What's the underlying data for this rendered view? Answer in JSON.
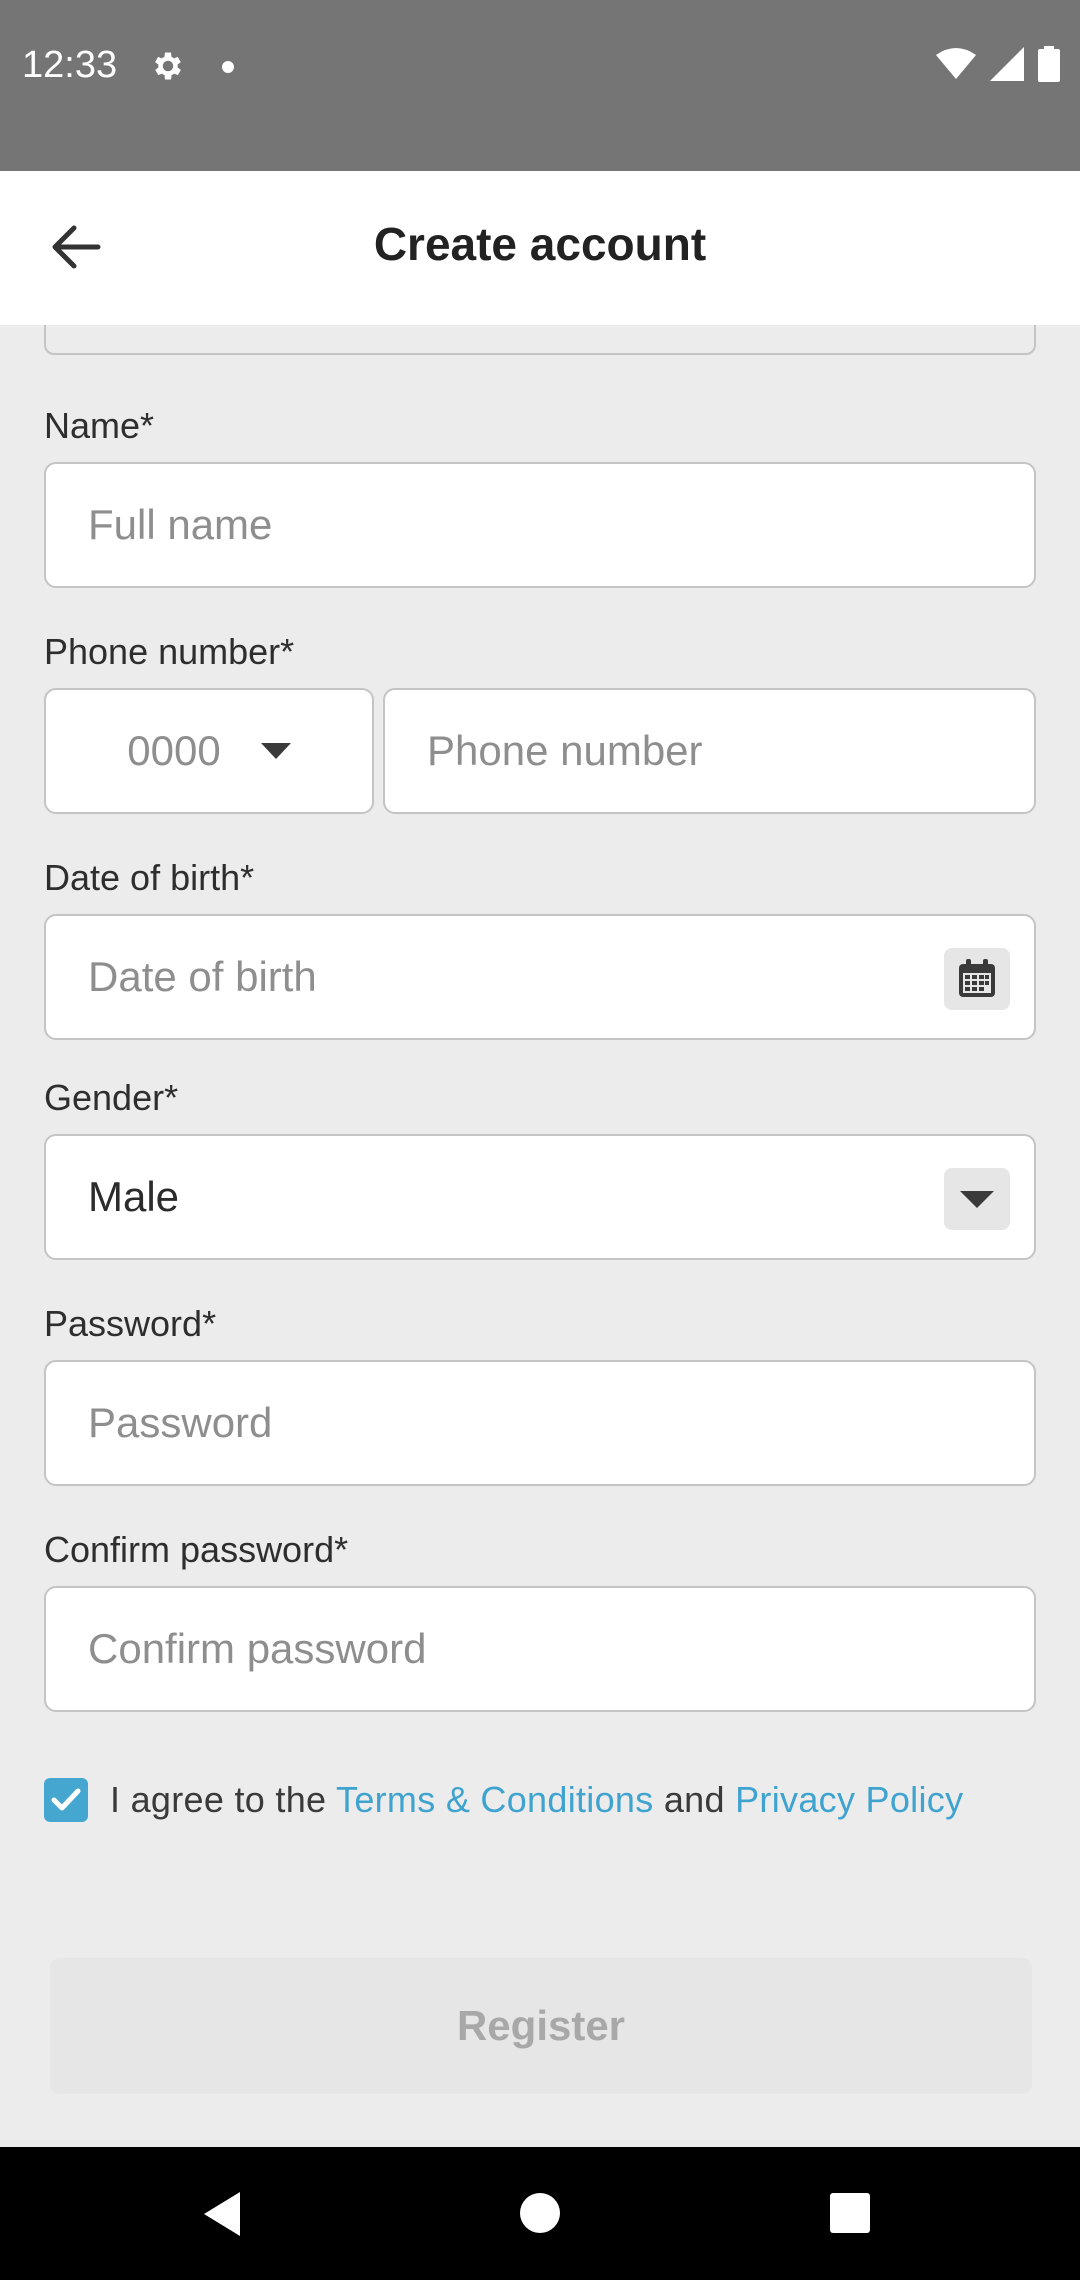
{
  "status_bar": {
    "time": "12:33"
  },
  "app_bar": {
    "title": "Create account"
  },
  "form": {
    "name": {
      "label": "Name*",
      "placeholder": "Full name"
    },
    "phone": {
      "label": "Phone number*",
      "country_code": "0000",
      "placeholder": "Phone number"
    },
    "dob": {
      "label": "Date of birth*",
      "placeholder": "Date of birth"
    },
    "gender": {
      "label": "Gender*",
      "value": "Male"
    },
    "password": {
      "label": "Password*",
      "placeholder": "Password"
    },
    "confirm_password": {
      "label": "Confirm password*",
      "placeholder": "Confirm password"
    },
    "agree": {
      "checked": true,
      "prefix": "I agree to the ",
      "terms_link": "Terms & Conditions",
      "middle": " and ",
      "privacy_link": "Privacy Policy"
    },
    "register_label": "Register"
  },
  "colors": {
    "accent": "#45a7d0",
    "link": "#3fa3cf",
    "status_bar": "#757575"
  },
  "icons": [
    "gear-icon",
    "wifi-icon",
    "signal-icon",
    "battery-icon",
    "back-arrow-icon",
    "chevron-down-icon",
    "calendar-icon",
    "checkmark-icon"
  ]
}
